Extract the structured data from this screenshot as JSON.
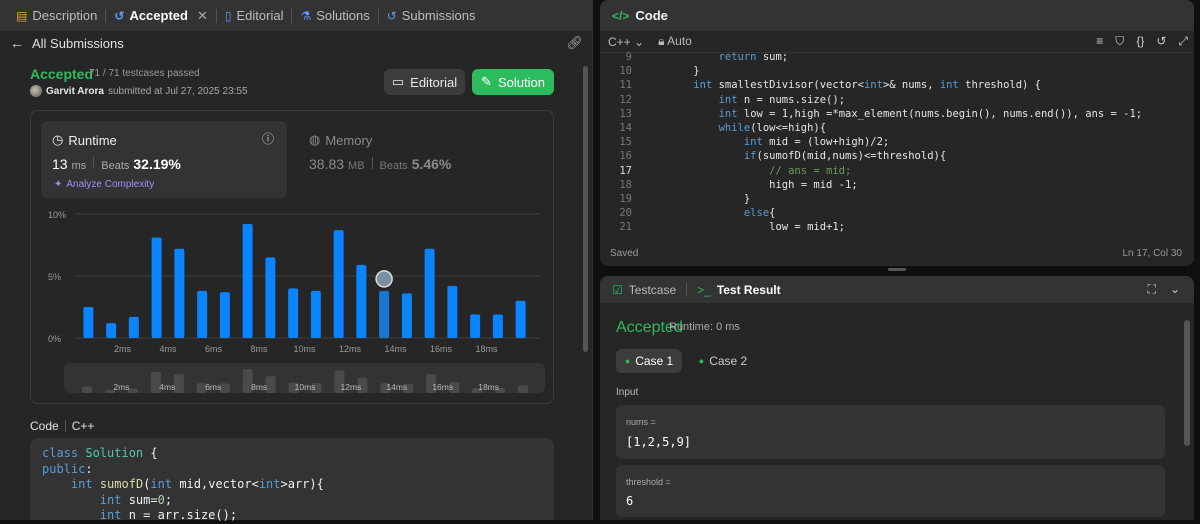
{
  "left_tabs": [
    {
      "label": "Description",
      "icon": "description-icon"
    },
    {
      "label": "Accepted",
      "icon": "history-icon",
      "closable": true
    },
    {
      "label": "Editorial",
      "icon": "book-icon"
    },
    {
      "label": "Solutions",
      "icon": "flask-icon"
    },
    {
      "label": "Submissions",
      "icon": "history-icon"
    }
  ],
  "submission": {
    "back_label": "All Submissions",
    "status": "Accepted",
    "testcases": "71 / 71 testcases passed",
    "author": "Garvit Arora",
    "submitted_text": "submitted at Jul 27, 2025 23:55",
    "editorial_btn": "Editorial",
    "solution_btn": "Solution"
  },
  "runtime": {
    "label": "Runtime",
    "value": "13",
    "unit": "ms",
    "beats_label": "Beats",
    "beats": "32.19%",
    "analyze": "Analyze Complexity"
  },
  "memory": {
    "label": "Memory",
    "value": "38.83",
    "unit": "MB",
    "beats_label": "Beats",
    "beats": "5.46%"
  },
  "chart_data": {
    "type": "bar",
    "y_ticks": [
      "10%",
      "5%",
      "0%"
    ],
    "ylim": [
      0,
      10
    ],
    "x_labels": [
      "2ms",
      "4ms",
      "6ms",
      "8ms",
      "10ms",
      "12ms",
      "14ms",
      "16ms",
      "18ms"
    ],
    "values": [
      2.5,
      1.2,
      1.7,
      8.1,
      7.2,
      3.8,
      3.7,
      9.2,
      6.5,
      4.0,
      3.8,
      8.7,
      5.9,
      3.8,
      3.6,
      7.2,
      4.2,
      1.9,
      1.9,
      3.0
    ],
    "highlight_index": 13,
    "bar_color": "#0a84ff",
    "highlight_color": "#1877d6"
  },
  "code_section": {
    "label": "Code",
    "lang": "C++",
    "lines": [
      "class Solution {",
      "public:",
      "    int sumofD(int mid,vector<int>arr){",
      "        int sum=0;",
      "        int n = arr.size();"
    ]
  },
  "editor": {
    "title": "Code",
    "lang": "C++",
    "mode": "Auto",
    "start_line": 9,
    "current_line": 17,
    "lines": [
      "        return sum;",
      "    }",
      "    int smallestDivisor(vector<int>& nums, int threshold) {",
      "        int n = nums.size();",
      "        int low = 1,high =*max_element(nums.begin(), nums.end()), ans = -1;",
      "        while(low<=high){",
      "            int mid = (low+high)/2;",
      "            if(sumofD(mid,nums)<=threshold){",
      "                // ans = mid;",
      "                high = mid -1;",
      "            }",
      "            else{",
      "                low = mid+1;"
    ],
    "saved": "Saved",
    "cursor": "Ln 17, Col 30"
  },
  "result": {
    "tab_testcase": "Testcase",
    "tab_result": "Test Result",
    "status": "Accepted",
    "runtime": "Runtime: 0 ms",
    "cases": [
      "Case 1",
      "Case 2"
    ],
    "input_label": "Input",
    "inputs": [
      {
        "name": "nums =",
        "value": "[1,2,5,9]"
      },
      {
        "name": "threshold =",
        "value": "6"
      }
    ]
  }
}
